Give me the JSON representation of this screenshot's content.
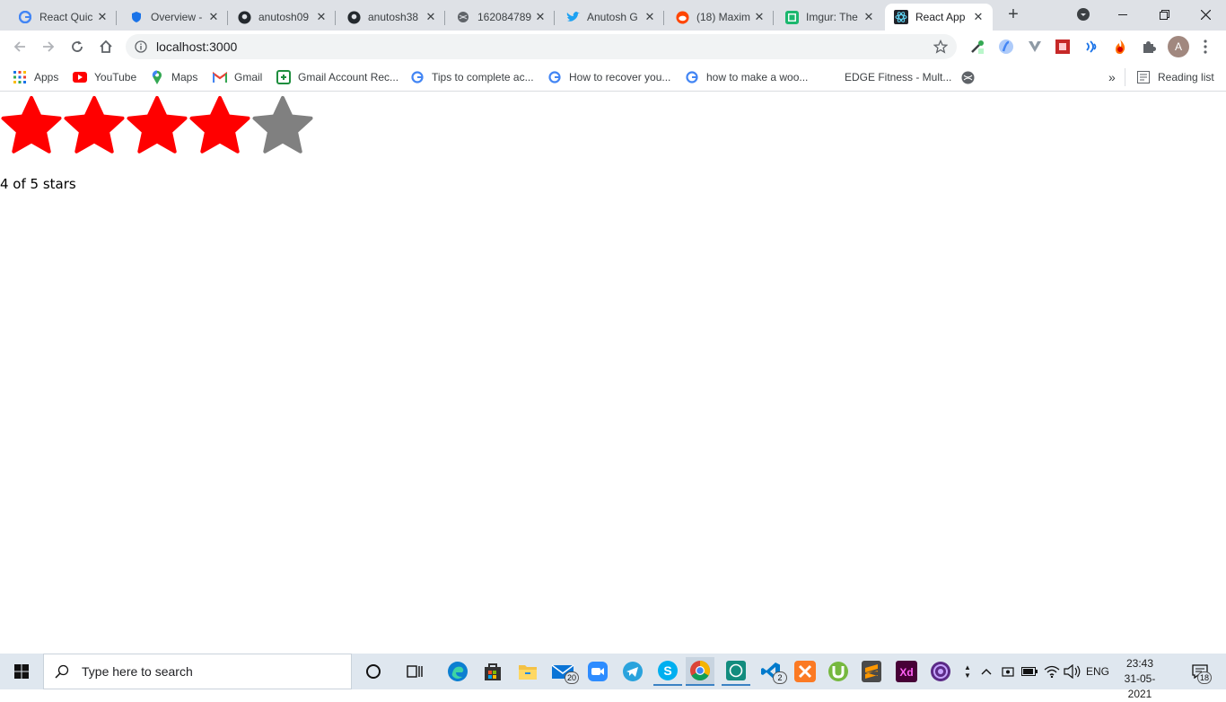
{
  "browser": {
    "tabs": [
      {
        "title": "React Quic",
        "icon": "google-icon"
      },
      {
        "title": "Overview -",
        "icon": "shield-icon"
      },
      {
        "title": "anutosh09",
        "icon": "github-icon"
      },
      {
        "title": "anutosh38",
        "icon": "github-icon"
      },
      {
        "title": "162084789",
        "icon": "globe-icon"
      },
      {
        "title": "Anutosh G",
        "icon": "twitter-icon"
      },
      {
        "title": "(18) Maxim",
        "icon": "reddit-icon"
      },
      {
        "title": "Imgur: The",
        "icon": "imgur-icon"
      },
      {
        "title": "React App",
        "icon": "react-icon",
        "active": true
      }
    ],
    "new_tab_label": "+",
    "address": "localhost:3000",
    "profile_initial": "A",
    "bookmarks": [
      {
        "label": "Apps",
        "icon": "apps-grid-icon"
      },
      {
        "label": "YouTube",
        "icon": "youtube-icon"
      },
      {
        "label": "Maps",
        "icon": "maps-pin-icon"
      },
      {
        "label": "Gmail",
        "icon": "gmail-icon"
      },
      {
        "label": "Gmail Account Rec...",
        "icon": "bookmark-green-icon"
      },
      {
        "label": "Tips to complete ac...",
        "icon": "google-icon"
      },
      {
        "label": "How to recover you...",
        "icon": "google-icon"
      },
      {
        "label": "how to make a woo...",
        "icon": "google-icon"
      },
      {
        "label": "EDGE Fitness - Mult...",
        "icon": ""
      }
    ],
    "reading_list": "Reading list",
    "more_bookmarks": "»"
  },
  "page": {
    "rating": {
      "value": 4,
      "max": 5,
      "filled_color": "#ff0000",
      "empty_color": "#808080"
    },
    "rating_text": "4 of 5 stars"
  },
  "taskbar": {
    "search_placeholder": "Type here to search",
    "mail_badge": "20",
    "vscode_badge": "2",
    "language": "ENG",
    "time": "23:43",
    "date": "31-05-2021",
    "notifications": "18"
  }
}
